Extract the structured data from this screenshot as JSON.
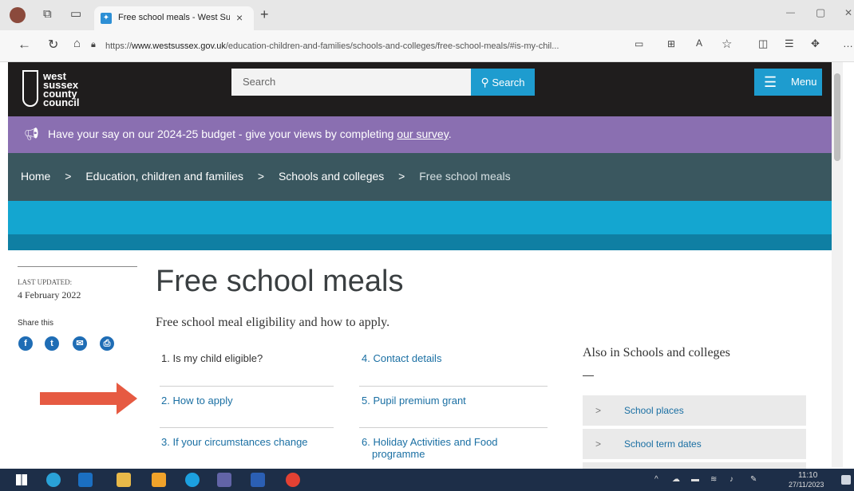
{
  "browser": {
    "tab_title": "Free school meals - West Sussex",
    "tab_close": "×",
    "new_tab": "+",
    "url_prefix": "https://",
    "url_host": "www.westsussex.gov.uk",
    "url_path": "/education-children-and-families/schools-and-colleges/free-school-meals/#is-my-chil...",
    "minimize": "—",
    "restore": "▢",
    "close": "✕"
  },
  "site": {
    "logo_lines": [
      "west",
      "sussex",
      "county",
      "council"
    ],
    "search_placeholder": "Search",
    "search_button": "Search",
    "menu_button": "Menu"
  },
  "banner": {
    "text": "Have your say on our 2024-25 budget - give your views by completing ",
    "link": "our survey",
    "end": "."
  },
  "breadcrumb": {
    "items": [
      "Home",
      "Education, children and families",
      "Schools and colleges"
    ],
    "current": "Free school meals",
    "separator": ">"
  },
  "page": {
    "last_updated_label": "LAST UPDATED:",
    "last_updated_date": "4 February 2022",
    "share_label": "Share this",
    "share_icons": [
      "facebook-icon",
      "twitter-icon",
      "email-icon",
      "print-icon"
    ],
    "title": "Free school meals",
    "subtitle": "Free school meal eligibility and how to apply.",
    "toc": [
      {
        "label": "1. Is my child eligible?",
        "current": true
      },
      {
        "label": "2. How to apply",
        "current": false
      },
      {
        "label": "3. If your circumstances change",
        "current": false
      },
      {
        "label": "4. Contact details",
        "current": false
      },
      {
        "label": "5. Pupil premium grant",
        "current": false
      },
      {
        "label": "6. Holiday Activities and Food programme",
        "current": false
      }
    ],
    "also_in_title": "Also in Schools and colleges",
    "also_in_dash": "—",
    "also_in_items": [
      "School places",
      "School term dates"
    ],
    "row_chevron": ">"
  },
  "taskbar": {
    "time": "11:10",
    "date": "27/11/2023"
  },
  "colors": {
    "header_bg": "#1f1d1d",
    "accent_blue": "#1e9ccf",
    "banner_purple": "#8a6fb1",
    "breadcrumb_bg": "#3a575f",
    "arrow_red": "#e65a42"
  }
}
